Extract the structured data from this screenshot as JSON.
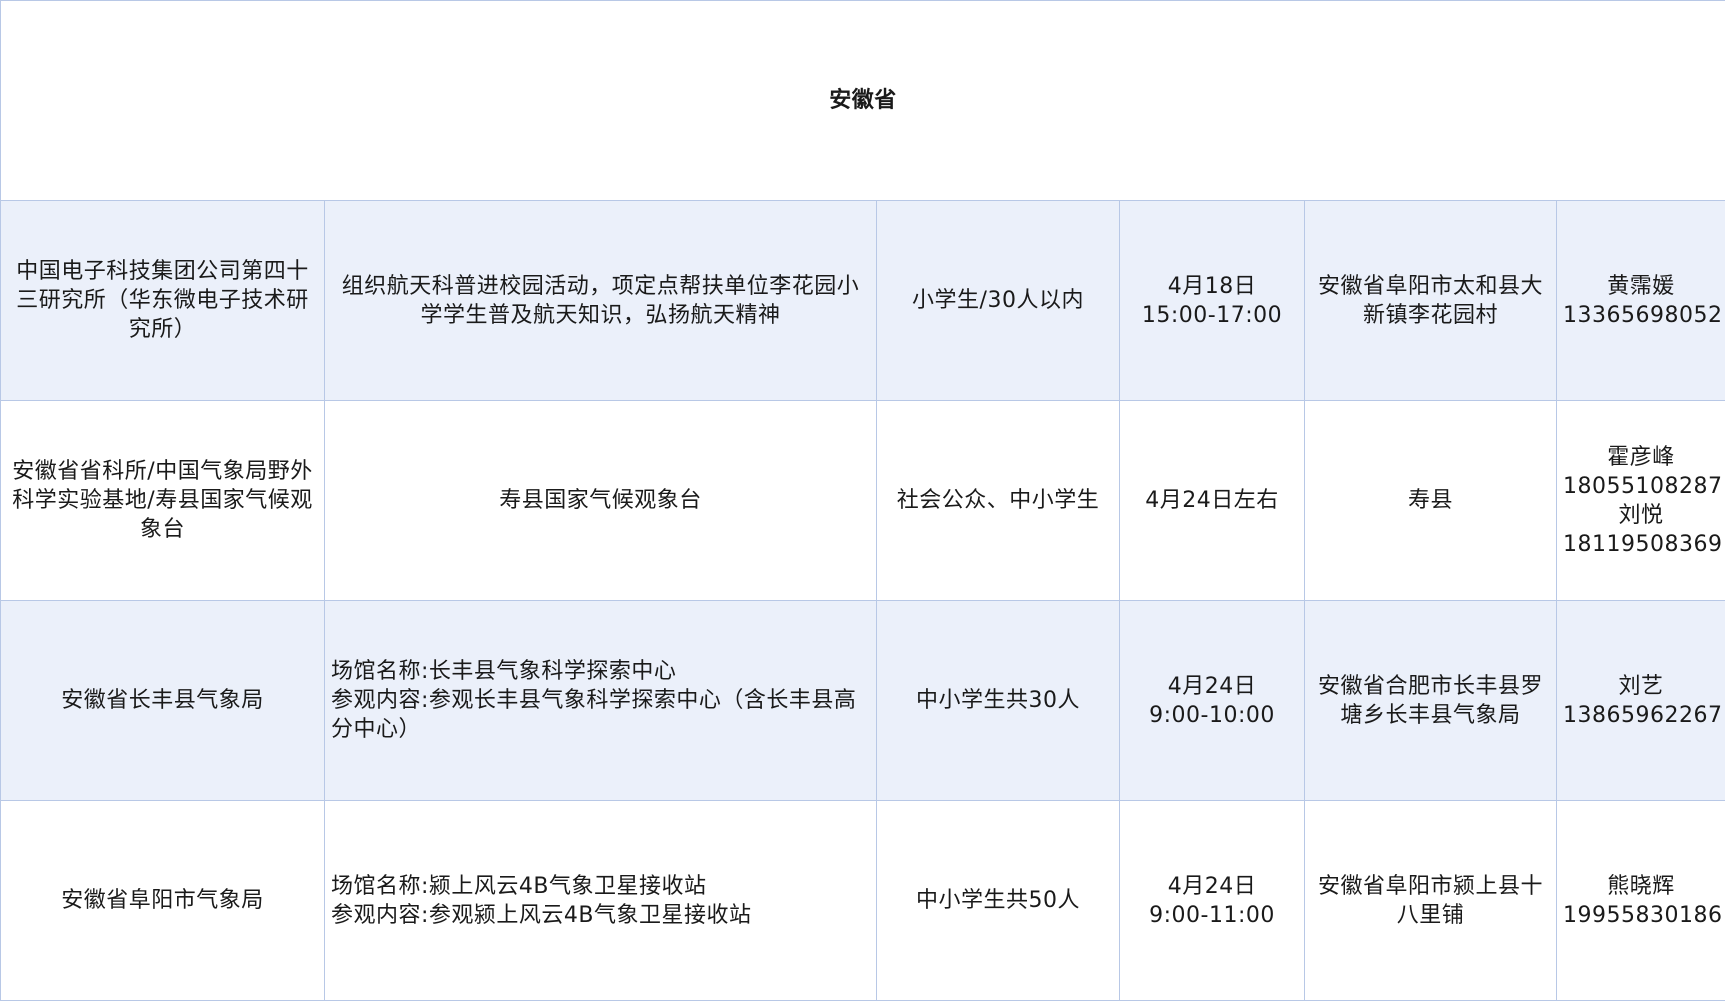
{
  "title": "安徽省",
  "rows": [
    {
      "org": "中国电子科技集团公司第四十三研究所（华东微电子技术研究所）",
      "activity": [
        "组织航天科普进校园活动，项定点帮扶单位李花园小学学生普及航天知识，弘扬航天精神"
      ],
      "audience": "小学生/30人以内",
      "time": [
        "4月18日",
        "15:00-17:00"
      ],
      "location": "安徽省阜阳市太和县大新镇李花园村",
      "contact": [
        "黄霈媛",
        "13365698052"
      ]
    },
    {
      "org": "安徽省省科所/中国气象局野外科学实验基地/寿县国家气候观象台",
      "activity": [
        "寿县国家气候观象台"
      ],
      "audience": "社会公众、中小学生",
      "time": [
        "4月24日左右"
      ],
      "location": "寿县",
      "contact": [
        "霍彦峰",
        "18055108287",
        "刘悦",
        "18119508369"
      ]
    },
    {
      "org": "安徽省长丰县气象局",
      "activity": [
        "场馆名称:长丰县气象科学探索中心",
        "参观内容:参观长丰县气象科学探索中心（含长丰县高分中心）"
      ],
      "audience": "中小学生共30人",
      "time": [
        "4月24日",
        "9:00-10:00"
      ],
      "location": "安徽省合肥市长丰县罗塘乡长丰县气象局",
      "contact": [
        "刘艺",
        "13865962267"
      ]
    },
    {
      "org": "安徽省阜阳市气象局",
      "activity": [
        "场馆名称:颍上风云4B气象卫星接收站",
        "参观内容:参观颍上风云4B气象卫星接收站"
      ],
      "audience": "中小学生共50人",
      "time": [
        "4月24日",
        "9:00-11:00"
      ],
      "location": "安徽省阜阳市颍上县十八里铺",
      "contact": [
        "熊晓辉",
        "19955830186"
      ]
    }
  ]
}
